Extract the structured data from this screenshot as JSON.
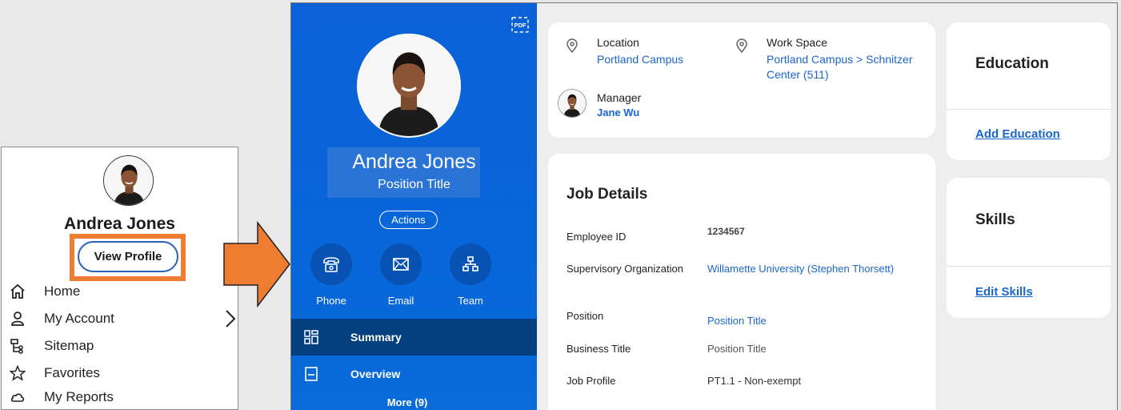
{
  "menu": {
    "user_name": "Andrea Jones",
    "view_profile_label": "View Profile",
    "items": [
      {
        "label": "Home",
        "icon": "home-icon"
      },
      {
        "label": "My Account",
        "icon": "user-icon"
      },
      {
        "label": "Sitemap",
        "icon": "sitemap-icon"
      },
      {
        "label": "Favorites",
        "icon": "star-icon"
      },
      {
        "label": "My Reports",
        "icon": "cloud-icon"
      }
    ]
  },
  "profile": {
    "name": "Andrea Jones",
    "position_title": "Position Title",
    "actions_label": "Actions",
    "quick_actions": [
      {
        "label": "Phone",
        "icon": "phone-icon"
      },
      {
        "label": "Email",
        "icon": "email-icon"
      },
      {
        "label": "Team",
        "icon": "org-chart-icon"
      }
    ],
    "nav": [
      {
        "label": "Summary",
        "icon": "dashboard-grid-icon"
      },
      {
        "label": "Overview",
        "icon": "document-icon"
      }
    ],
    "more_label": "More (9)"
  },
  "location_card": {
    "location_label": "Location",
    "location_value": "Portland Campus",
    "workspace_label": "Work Space",
    "workspace_line1": "Portland Campus > Schnitzer",
    "workspace_line2": "Center (511)",
    "manager_label": "Manager",
    "manager_name": "Jane Wu"
  },
  "job_details": {
    "title": "Job Details",
    "rows": [
      {
        "label": "Employee ID",
        "value": "1234567"
      },
      {
        "label": "Supervisory Organization",
        "value": "Willamette University (Stephen Thorsett)"
      },
      {
        "label": "Position",
        "value": "Position Title"
      },
      {
        "label": "Business Title",
        "value": "Position Title"
      },
      {
        "label": "Job Profile",
        "value": "PT1.1 - Non-exempt"
      }
    ]
  },
  "education": {
    "title": "Education",
    "link": "Add Education"
  },
  "skills": {
    "title": "Skills",
    "link": "Edit Skills"
  },
  "colors": {
    "accent_orange": "#ee7d31",
    "sidebar_blue": "#0b62d8",
    "link_blue": "#1a66cc",
    "nav_active": "#04407f"
  }
}
